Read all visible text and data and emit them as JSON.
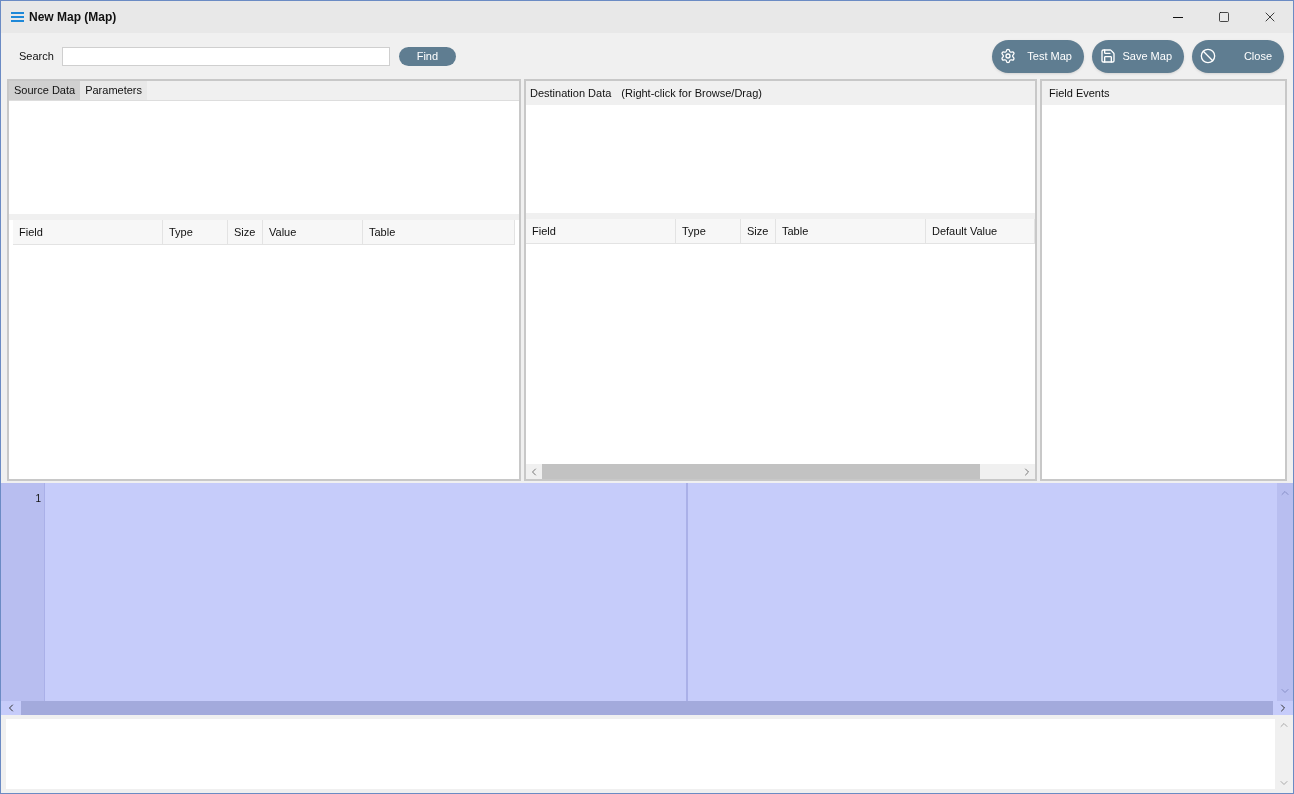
{
  "window": {
    "title": "New Map (Map)"
  },
  "search": {
    "label": "Search",
    "button": "Find"
  },
  "actions": [
    {
      "kind": "gear",
      "label": "Test Map"
    },
    {
      "kind": "save",
      "label": "Save Map"
    },
    {
      "kind": "ban",
      "label": "Close"
    }
  ],
  "source": {
    "tabs": [
      {
        "label": "Source Data",
        "selected": true
      },
      {
        "label": "Parameters",
        "selected": false
      }
    ],
    "columns": [
      "Field",
      "Type",
      "Size",
      "Value",
      "Table"
    ]
  },
  "destination": {
    "title": "Destination Data",
    "hint": "(Right-click for Browse/Drag)",
    "columns": [
      "Field",
      "Type",
      "Size",
      "Table",
      "Default Value"
    ]
  },
  "field_events": {
    "title": "Field Events"
  },
  "editor": {
    "line_numbers": [
      "1"
    ]
  }
}
